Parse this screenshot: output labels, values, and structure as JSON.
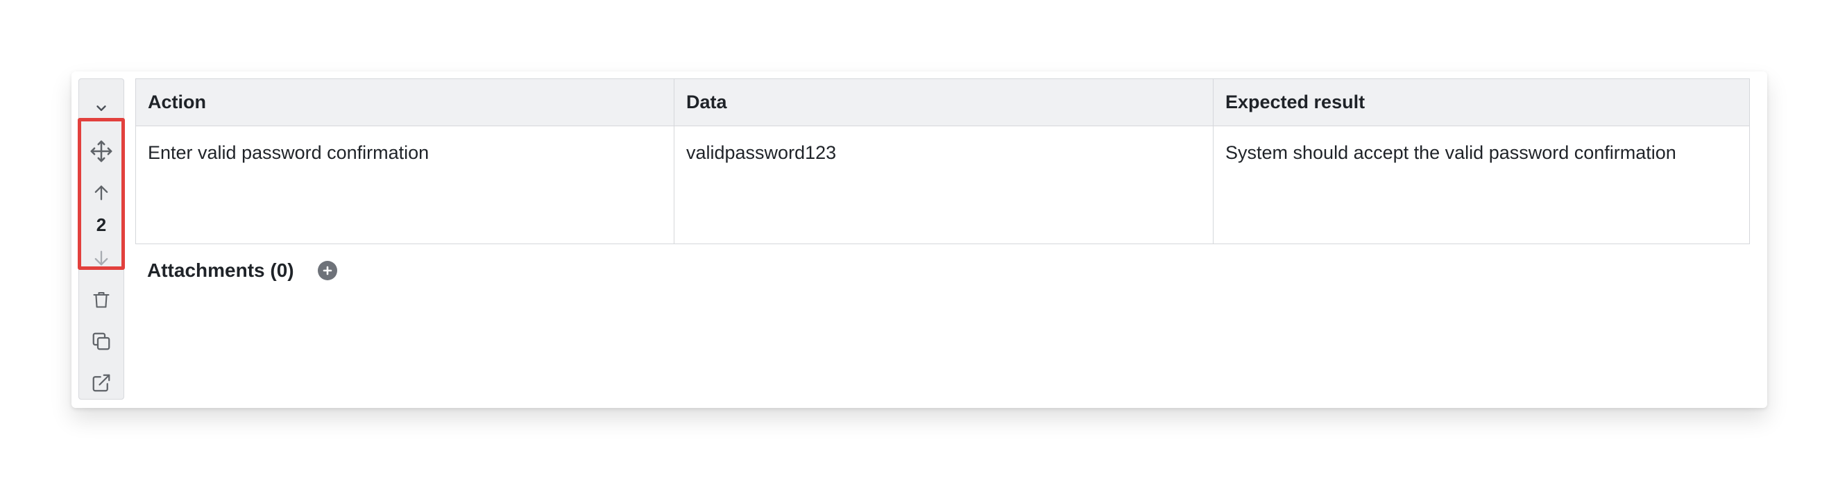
{
  "toolbar": {
    "icons": [
      "chevron-down-icon",
      "move-icon",
      "arrow-up-icon",
      "arrow-down-icon",
      "trash-icon",
      "copy-icon",
      "external-link-icon"
    ],
    "step_number": "2"
  },
  "table": {
    "headers": [
      "Action",
      "Data",
      "Expected result"
    ],
    "rows": [
      [
        "Enter valid password confirmation",
        "validpassword123",
        "System should accept the valid password confirmation"
      ]
    ]
  },
  "attachments": {
    "label": "Attachments (0)"
  },
  "colors": {
    "highlight": "#e2403d",
    "header_bg": "#f0f1f3",
    "toolbar_bg": "#eeeff1",
    "icon": "#5f6368"
  }
}
